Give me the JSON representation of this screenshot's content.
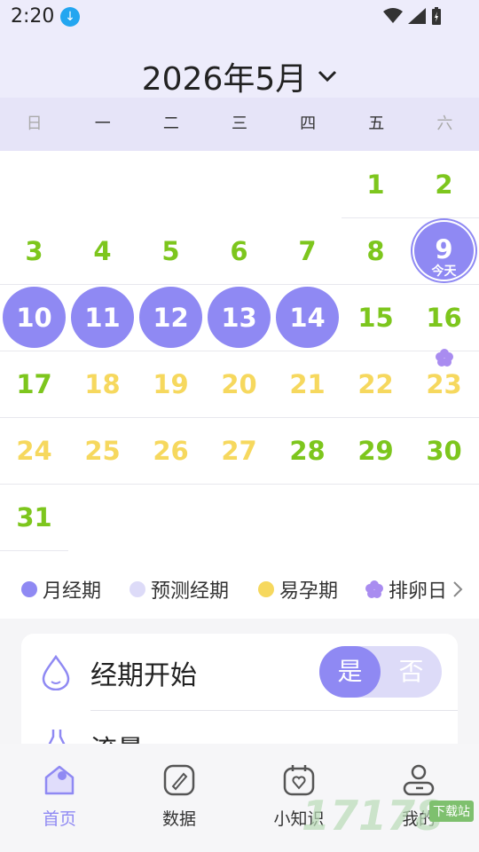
{
  "status": {
    "time": "2:20"
  },
  "header": {
    "month_title": "2026年5月"
  },
  "weekdays": [
    "日",
    "一",
    "二",
    "三",
    "四",
    "五",
    "六"
  ],
  "days": [
    {
      "n": "1"
    },
    {
      "n": "2"
    },
    {
      "n": "3"
    },
    {
      "n": "4"
    },
    {
      "n": "5"
    },
    {
      "n": "6"
    },
    {
      "n": "7"
    },
    {
      "n": "8"
    },
    {
      "n": "9",
      "today_label": "今天"
    },
    {
      "n": "10"
    },
    {
      "n": "11"
    },
    {
      "n": "12"
    },
    {
      "n": "13"
    },
    {
      "n": "14"
    },
    {
      "n": "15"
    },
    {
      "n": "16"
    },
    {
      "n": "17"
    },
    {
      "n": "18"
    },
    {
      "n": "19"
    },
    {
      "n": "20"
    },
    {
      "n": "21"
    },
    {
      "n": "22"
    },
    {
      "n": "23"
    },
    {
      "n": "24"
    },
    {
      "n": "25"
    },
    {
      "n": "26"
    },
    {
      "n": "27"
    },
    {
      "n": "28"
    },
    {
      "n": "29"
    },
    {
      "n": "30"
    },
    {
      "n": "31"
    }
  ],
  "legend": {
    "period": "月经期",
    "predicted": "预测经期",
    "fertile": "易孕期",
    "ovulation": "排卵日"
  },
  "colors": {
    "period": "#8f89f3",
    "predicted": "#dddbf8",
    "fertile": "#f6d85e",
    "normal": "#7dc61d"
  },
  "card": {
    "period_start_label": "经期开始",
    "yes": "是",
    "no": "否",
    "flow_label": "流量"
  },
  "nav": {
    "home": "首页",
    "data": "数据",
    "knowledge": "小知识",
    "mine": "我的"
  }
}
